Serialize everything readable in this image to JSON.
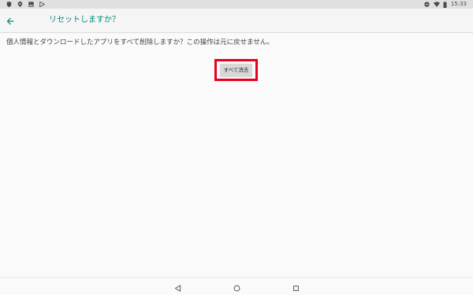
{
  "status_bar": {
    "time": "15:33",
    "left_icons": [
      "shield-icon",
      "location-pin-icon",
      "image-icon",
      "play-store-icon"
    ],
    "right_icons": [
      "do-not-disturb-icon",
      "wifi-icon",
      "battery-icon"
    ]
  },
  "app_bar": {
    "title": "リセットしますか？",
    "back_icon": "arrow-back-icon",
    "accent_color": "#00897b"
  },
  "content": {
    "message": "個人情報とダウンロードしたアプリをすべて削除しますか？この操作は元に戻せません。",
    "erase_button_label": "すべて消去",
    "highlight_color": "#e8001c"
  },
  "nav_bar": {
    "icons": [
      "back-triangle-icon",
      "home-circle-icon",
      "recents-square-icon"
    ]
  }
}
